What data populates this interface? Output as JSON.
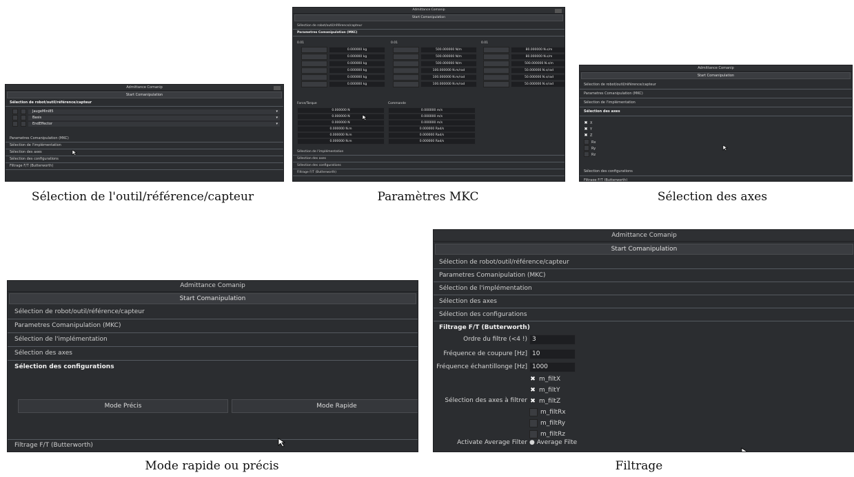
{
  "captions": {
    "p1": "Sélection de l'outil/référence/capteur",
    "p2": "Paramètres MKC",
    "p3": "Sélection des axes",
    "p4": "Mode rapide ou précis",
    "p5": "Filtrage"
  },
  "window": {
    "title": "Admittance Comanip",
    "start_button": "Start Comanipulation"
  },
  "sections": {
    "robot": "Sélection de robot/outil/référence/capteur",
    "mkc": "Parametres Comanipulation (MKC)",
    "impl": "Sélection de l'implémentation",
    "axes": "Sélection des axes",
    "configs": "Sélection des configurations",
    "filter": "Filtrage F/T (Butterworth)"
  },
  "panel1": {
    "dropdowns": [
      "JaugeMini85",
      "Basis",
      "EndEffector"
    ]
  },
  "panel2": {
    "col_headers": [
      "0.01",
      "0.01",
      "0.01"
    ],
    "mass": [
      "0.000000 kg",
      "0.000000 kg",
      "0.000000 kg",
      "0.000000 kg",
      "0.000000 kg",
      "0.000000 kg"
    ],
    "stiffness": [
      "500.000000 N/m",
      "500.000000 N/m",
      "500.000000 N/m",
      "100.000000 N.m/rad",
      "100.000000 N.m/rad",
      "100.000000 N.m/rad"
    ],
    "damping": [
      "80.000000 N.s/m",
      "80.000000 N.s/m",
      "500.000000 N.s/m",
      "50.000000 N.s/rad",
      "50.000000 N.s/rad",
      "50.000000 N.s/rad"
    ],
    "force_label": "Force/Torque",
    "command_label": "Commande",
    "force": [
      "0.000000 N",
      "0.000000 N",
      "0.000000 N",
      "0.000000 N.m",
      "0.000000 N.m",
      "0.000000 N.m"
    ],
    "command": [
      "0.000000 m/s",
      "0.000000 m/s",
      "0.000000 m/s",
      "0.000000 Rad/s",
      "0.000000 Rad/s",
      "0.000000 Rad/s"
    ]
  },
  "panel3": {
    "axes": [
      {
        "label": "X",
        "checked": true
      },
      {
        "label": "Y",
        "checked": true
      },
      {
        "label": "Z",
        "checked": true
      },
      {
        "label": "Rx",
        "checked": false
      },
      {
        "label": "Ry",
        "checked": false
      },
      {
        "label": "Rz",
        "checked": false
      }
    ]
  },
  "panel4": {
    "mode_precise": "Mode Précis",
    "mode_fast": "Mode Rapide"
  },
  "panel5": {
    "order_label": "Ordre du filtre (<4 !)",
    "order_value": "3",
    "cutoff_label": "Fréquence de coupure [Hz]",
    "cutoff_value": "10",
    "sampling_label": "Fréquence échantillonge [Hz]",
    "sampling_value": "1000",
    "axes_label": "Sélection des axes à filtrer",
    "filter_axes": [
      {
        "label": "m_filtX",
        "checked": true
      },
      {
        "label": "m_filtY",
        "checked": true
      },
      {
        "label": "m_filtZ",
        "checked": true
      },
      {
        "label": "m_filtRx",
        "checked": false
      },
      {
        "label": "m_filtRy",
        "checked": false
      },
      {
        "label": "m_filtRz",
        "checked": false
      }
    ],
    "avg_label": "Activate Average Filter",
    "avg_option": "Average Filte"
  },
  "colors": {
    "panel_bg": "#2b2d30",
    "field_bg": "#1d1e21",
    "header_line": "#555a60"
  }
}
